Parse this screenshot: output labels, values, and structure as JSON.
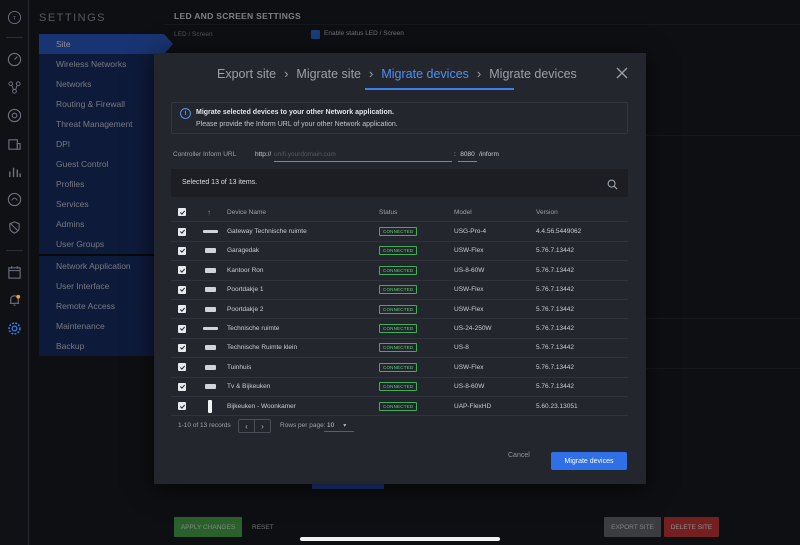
{
  "settings": {
    "title": "SETTINGS",
    "nav_group1": [
      "Site",
      "Wireless Networks",
      "Networks",
      "Routing & Firewall",
      "Threat Management",
      "DPI",
      "Guest Control",
      "Profiles",
      "Services",
      "Admins",
      "User Groups"
    ],
    "nav_group2": [
      "Network Application",
      "User Interface",
      "Remote Access",
      "Maintenance",
      "Backup"
    ],
    "active_item": "Site"
  },
  "background": {
    "section_title": "LED AND SCREEN SETTINGS",
    "led_label": "LED / Screen",
    "led_checkbox_label": "Enable status LED / Screen",
    "apply_label": "APPLY CHANGES",
    "reset_label": "RESET",
    "export_label": "EXPORT SITE",
    "delete_label": "DELETE SITE"
  },
  "modal": {
    "steps": [
      "Export site",
      "Migrate site",
      "Migrate devices",
      "Migrate devices"
    ],
    "current_step_index": 2,
    "info_title": "Migrate selected devices to your other Network application.",
    "info_text": "Please provide the Inform URL of your other Network application.",
    "url_label": "Controller Inform URL",
    "url_prefix": "http://",
    "url_placeholder": "unifi.yourdomain.com",
    "url_colon": ":",
    "port_value": "8080",
    "url_suffix": "/inform",
    "selection_text": "Selected 13 of 13 items.",
    "columns": {
      "name": "Device Name",
      "status": "Status",
      "model": "Model",
      "version": "Version"
    },
    "devices": [
      {
        "name": "Gateway Technische ruimte",
        "status": "CONNECTED",
        "model": "USG-Pro-4",
        "version": "4.4.56.5449062",
        "icon": "gateway-flat"
      },
      {
        "name": "Garagedak",
        "status": "CONNECTED",
        "model": "USW-Flex",
        "version": "5.76.7.13442",
        "icon": "switch-small"
      },
      {
        "name": "Kantoor Ron",
        "status": "CONNECTED",
        "model": "US-8-60W",
        "version": "5.76.7.13442",
        "icon": "switch-small"
      },
      {
        "name": "Poortdakje 1",
        "status": "CONNECTED",
        "model": "USW-Flex",
        "version": "5.76.7.13442",
        "icon": "switch-small"
      },
      {
        "name": "Poortdakje 2",
        "status": "CONNECTED",
        "model": "USW-Flex",
        "version": "5.76.7.13442",
        "icon": "switch-small"
      },
      {
        "name": "Technische ruimte",
        "status": "CONNECTED",
        "model": "US-24-250W",
        "version": "5.76.7.13442",
        "icon": "switch-flat"
      },
      {
        "name": "Technische Ruimte klein",
        "status": "CONNECTED",
        "model": "US-8",
        "version": "5.76.7.13442",
        "icon": "switch-small"
      },
      {
        "name": "Tuinhuis",
        "status": "CONNECTED",
        "model": "USW-Flex",
        "version": "5.76.7.13442",
        "icon": "switch-small"
      },
      {
        "name": "Tv & Bijkeuken",
        "status": "CONNECTED",
        "model": "US-8-60W",
        "version": "5.76.7.13442",
        "icon": "switch-small"
      },
      {
        "name": "Bijkeuken - Woonkamer",
        "status": "CONNECTED",
        "model": "UAP-FlexHD",
        "version": "5.60.23.13051",
        "icon": "ap-tall"
      }
    ],
    "pager_text": "1-10 of 13 records",
    "rows_per_page_label": "Rows per page:",
    "rows_per_page_value": "10",
    "cancel_label": "Cancel",
    "migrate_label": "Migrate devices"
  }
}
